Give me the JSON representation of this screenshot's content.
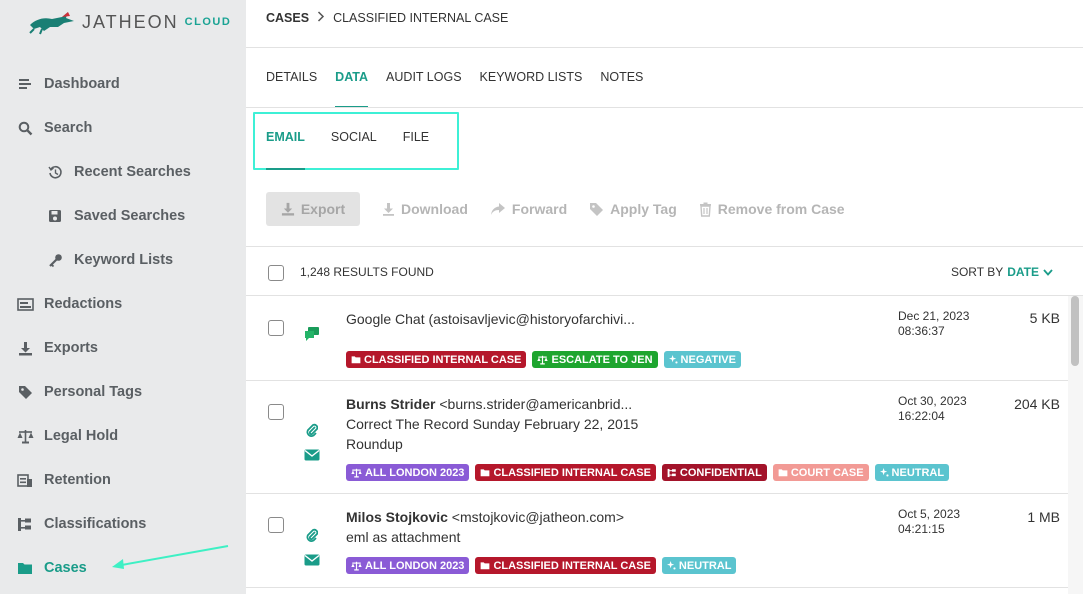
{
  "brand": {
    "name": "JATHEON",
    "suffix": "CLOUD"
  },
  "sidebar": {
    "items": [
      {
        "label": "Dashboard",
        "icon": "list-icon"
      },
      {
        "label": "Search",
        "icon": "search-icon"
      },
      {
        "label": "Recent Searches",
        "icon": "history-icon"
      },
      {
        "label": "Saved Searches",
        "icon": "save-icon"
      },
      {
        "label": "Keyword Lists",
        "icon": "key-icon"
      },
      {
        "label": "Redactions",
        "icon": "redaction-icon"
      },
      {
        "label": "Exports",
        "icon": "download-icon"
      },
      {
        "label": "Personal Tags",
        "icon": "tag-icon"
      },
      {
        "label": "Legal Hold",
        "icon": "scale-icon"
      },
      {
        "label": "Retention",
        "icon": "archive-icon"
      },
      {
        "label": "Classifications",
        "icon": "hierarchy-icon"
      },
      {
        "label": "Cases",
        "icon": "folder-icon"
      }
    ]
  },
  "breadcrumb": {
    "root": "CASES",
    "current": "CLASSIFIED INTERNAL CASE"
  },
  "tabs": [
    "DETAILS",
    "DATA",
    "AUDIT LOGS",
    "KEYWORD LISTS",
    "NOTES"
  ],
  "subtabs": [
    "EMAIL",
    "SOCIAL",
    "FILE"
  ],
  "toolbar": {
    "export": "Export",
    "download": "Download",
    "forward": "Forward",
    "apply_tag": "Apply Tag",
    "remove": "Remove from Case"
  },
  "results": {
    "count_text": "1,248 RESULTS FOUND",
    "sort_label": "SORT BY",
    "sort_value": "DATE"
  },
  "rows": [
    {
      "sender": "",
      "line1": "Google Chat (astoisavljevic@historyofarchivi...",
      "line2": "",
      "line3": "",
      "date": "Dec 21, 2023",
      "time": "08:36:37",
      "size": "5 KB",
      "tags": [
        {
          "label": "CLASSIFIED INTERNAL CASE",
          "color": "#b5172b",
          "icon": "folder"
        },
        {
          "label": "ESCALATE TO JEN",
          "color": "#1ea52f",
          "icon": "scale"
        },
        {
          "label": "NEGATIVE",
          "color": "#5bc4cf",
          "icon": "sparkle"
        }
      ]
    },
    {
      "sender": "Burns Strider",
      "line1": " <burns.strider@americanbrid...",
      "line2": "Correct The Record Sunday February 22, 2015",
      "line3": "Roundup",
      "date": "Oct 30, 2023",
      "time": "16:22:04",
      "size": "204 KB",
      "tags": [
        {
          "label": "ALL LONDON 2023",
          "color": "#8a5bd6",
          "icon": "scale"
        },
        {
          "label": "CLASSIFIED INTERNAL CASE",
          "color": "#b5172b",
          "icon": "folder"
        },
        {
          "label": "CONFIDENTIAL",
          "color": "#a3132a",
          "icon": "hierarchy"
        },
        {
          "label": "COURT CASE",
          "color": "#f29a95",
          "icon": "folder"
        },
        {
          "label": "NEUTRAL",
          "color": "#5bc4cf",
          "icon": "sparkle"
        }
      ]
    },
    {
      "sender": "Milos Stojkovic",
      "line1": " <mstojkovic@jatheon.com>",
      "line2": "eml as attachment",
      "line3": "",
      "date": "Oct 5, 2023",
      "time": "04:21:15",
      "size": "1 MB",
      "tags": [
        {
          "label": "ALL LONDON 2023",
          "color": "#8a5bd6",
          "icon": "scale"
        },
        {
          "label": "CLASSIFIED INTERNAL CASE",
          "color": "#b5172b",
          "icon": "folder"
        },
        {
          "label": "NEUTRAL",
          "color": "#5bc4cf",
          "icon": "sparkle"
        }
      ]
    }
  ],
  "colors": {
    "accent": "#1a9c89",
    "highlight_box": "#3ef0d6",
    "sidebar_bg": "#e9eaeb"
  }
}
